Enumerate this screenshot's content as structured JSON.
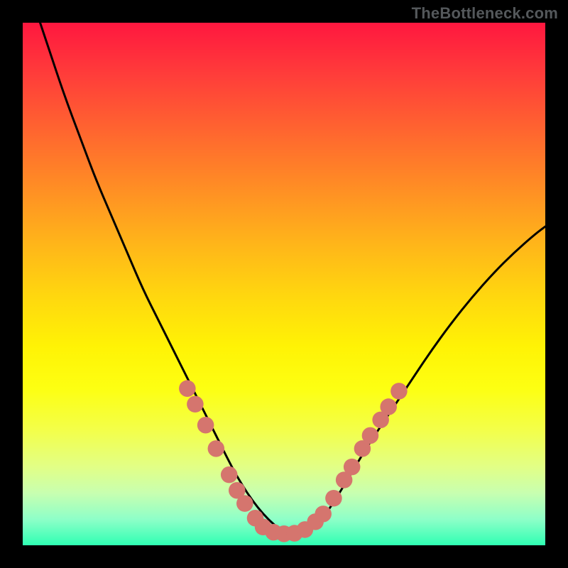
{
  "watermark": "TheBottleneck.com",
  "chart_data": {
    "type": "line",
    "title": "",
    "xlabel": "",
    "ylabel": "",
    "xlim": [
      0,
      100
    ],
    "ylim": [
      0,
      100
    ],
    "grid": false,
    "series": [
      {
        "name": "bottleneck-curve",
        "stroke": "#000000",
        "stroke_width": 3,
        "x": [
          3,
          5,
          8,
          11,
          14,
          17,
          20,
          23,
          26,
          29,
          32,
          34,
          36,
          38,
          40,
          42,
          44,
          46,
          48,
          50,
          52,
          54,
          56,
          58,
          60,
          63,
          66,
          70,
          74,
          78,
          82,
          86,
          90,
          94,
          98,
          100
        ],
        "values": [
          101,
          95,
          86,
          78,
          70,
          63,
          56,
          49,
          43,
          37,
          31,
          27,
          23,
          19,
          15,
          11.5,
          8.5,
          6,
          4,
          2.5,
          2,
          2.5,
          3.8,
          6,
          9,
          14,
          19,
          25,
          31,
          37,
          42.5,
          47.5,
          52,
          56,
          59.5,
          61
        ]
      }
    ],
    "markers": [
      {
        "x": 31.5,
        "y": 30,
        "r": 1.6,
        "fill": "#d5756e"
      },
      {
        "x": 33,
        "y": 27,
        "r": 1.6,
        "fill": "#d5756e"
      },
      {
        "x": 35,
        "y": 23,
        "r": 1.6,
        "fill": "#d5756e"
      },
      {
        "x": 37,
        "y": 18.5,
        "r": 1.6,
        "fill": "#d5756e"
      },
      {
        "x": 39.5,
        "y": 13.5,
        "r": 1.6,
        "fill": "#d5756e"
      },
      {
        "x": 41,
        "y": 10.5,
        "r": 1.6,
        "fill": "#d5756e"
      },
      {
        "x": 42.5,
        "y": 8,
        "r": 1.6,
        "fill": "#d5756e"
      },
      {
        "x": 44.5,
        "y": 5.2,
        "r": 1.6,
        "fill": "#d5756e"
      },
      {
        "x": 46,
        "y": 3.5,
        "r": 1.6,
        "fill": "#d5756e"
      },
      {
        "x": 48,
        "y": 2.5,
        "r": 1.6,
        "fill": "#d5756e"
      },
      {
        "x": 50,
        "y": 2.2,
        "r": 1.6,
        "fill": "#d5756e"
      },
      {
        "x": 52,
        "y": 2.3,
        "r": 1.6,
        "fill": "#d5756e"
      },
      {
        "x": 54,
        "y": 3,
        "r": 1.6,
        "fill": "#d5756e"
      },
      {
        "x": 56,
        "y": 4.5,
        "r": 1.6,
        "fill": "#d5756e"
      },
      {
        "x": 57.5,
        "y": 6,
        "r": 1.6,
        "fill": "#d5756e"
      },
      {
        "x": 59.5,
        "y": 9,
        "r": 1.6,
        "fill": "#d5756e"
      },
      {
        "x": 61.5,
        "y": 12.5,
        "r": 1.6,
        "fill": "#d5756e"
      },
      {
        "x": 63,
        "y": 15,
        "r": 1.6,
        "fill": "#d5756e"
      },
      {
        "x": 65,
        "y": 18.5,
        "r": 1.6,
        "fill": "#d5756e"
      },
      {
        "x": 66.5,
        "y": 21,
        "r": 1.6,
        "fill": "#d5756e"
      },
      {
        "x": 68.5,
        "y": 24,
        "r": 1.6,
        "fill": "#d5756e"
      },
      {
        "x": 70,
        "y": 26.5,
        "r": 1.6,
        "fill": "#d5756e"
      },
      {
        "x": 72,
        "y": 29.5,
        "r": 1.6,
        "fill": "#d5756e"
      }
    ]
  }
}
